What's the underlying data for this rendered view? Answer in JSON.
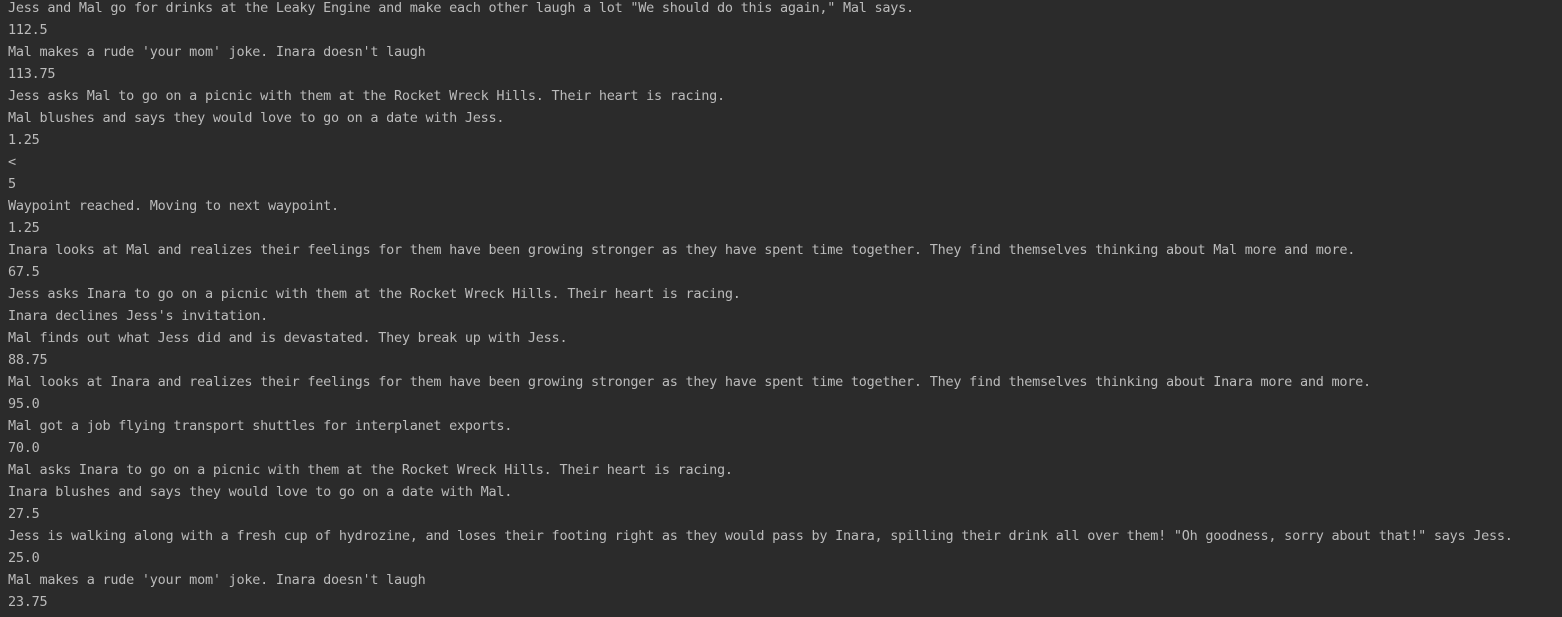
{
  "console": {
    "lines": [
      "Jess and Mal go for drinks at the Leaky Engine and make each other laugh a lot \"We should do this again,\" Mal says.",
      "112.5",
      "Mal makes a rude 'your mom' joke. Inara doesn't laugh",
      "113.75",
      "Jess asks Mal to go on a picnic with them at the Rocket Wreck Hills. Their heart is racing.",
      "Mal blushes and says they would love to go on a date with Jess.",
      "1.25",
      "<",
      "5",
      "Waypoint reached. Moving to next waypoint.",
      "1.25",
      "Inara looks at Mal and realizes their feelings for them have been growing stronger as they have spent time together. They find themselves thinking about Mal more and more.",
      "67.5",
      "Jess asks Inara to go on a picnic with them at the Rocket Wreck Hills. Their heart is racing.",
      "Inara declines Jess's invitation.",
      "Mal finds out what Jess did and is devastated. They break up with Jess.",
      "88.75",
      "Mal looks at Inara and realizes their feelings for them have been growing stronger as they have spent time together. They find themselves thinking about Inara more and more.",
      "95.0",
      "Mal got a job flying transport shuttles for interplanet exports.",
      "70.0",
      "Mal asks Inara to go on a picnic with them at the Rocket Wreck Hills. Their heart is racing.",
      "Inara blushes and says they would love to go on a date with Mal.",
      "27.5",
      "Jess is walking along with a fresh cup of hydrozine, and loses their footing right as they would pass by Inara, spilling their drink all over them! \"Oh goodness, sorry about that!\" says Jess.",
      "25.0",
      "Mal makes a rude 'your mom' joke. Inara doesn't laugh",
      "23.75"
    ]
  },
  "colors": {
    "background": "#2b2b2b",
    "text": "#bbbbbb"
  }
}
